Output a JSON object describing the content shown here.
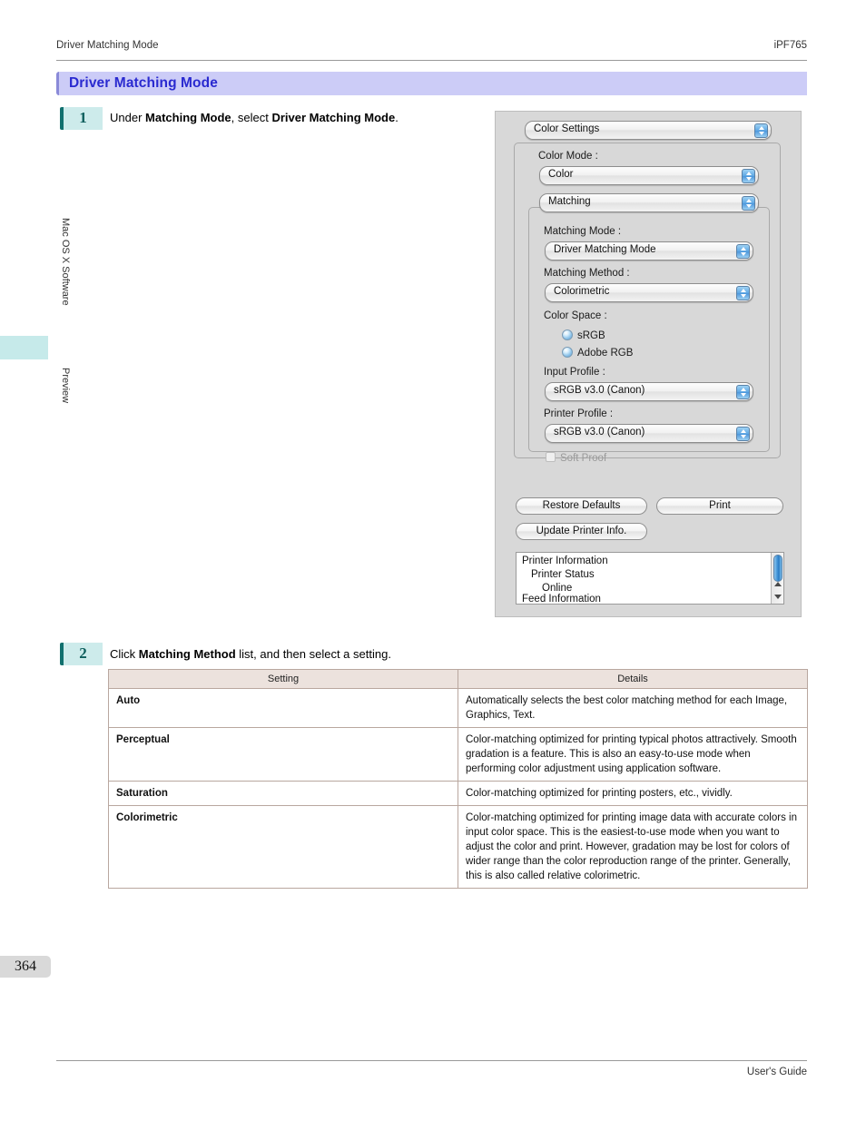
{
  "header": {
    "left": "Driver Matching Mode",
    "right": "iPF765"
  },
  "section": {
    "title": "Driver Matching Mode",
    "title_bg": "#ccccf7",
    "title_color": "#2a2ad0"
  },
  "side_tabs": {
    "software": "Mac OS X Software",
    "preview": "Preview",
    "marker_color": "#c6eaea"
  },
  "steps": [
    {
      "number": "1",
      "parts": [
        {
          "text": "Under ",
          "bold": false
        },
        {
          "text": "Matching Mode",
          "bold": true
        },
        {
          "text": ", select ",
          "bold": false
        },
        {
          "text": "Driver Matching Mode",
          "bold": true
        },
        {
          "text": ".",
          "bold": false
        }
      ]
    },
    {
      "number": "2",
      "parts": [
        {
          "text": "Click ",
          "bold": false
        },
        {
          "text": "Matching Method",
          "bold": true
        },
        {
          "text": " list, and then select a setting.",
          "bold": false
        }
      ]
    }
  ],
  "dialog": {
    "pane_popup": "Color Settings",
    "color_mode_label": "Color Mode :",
    "color_mode_value": "Color",
    "matching_popup": "Matching",
    "matching_mode_label": "Matching Mode :",
    "matching_mode_value": "Driver Matching Mode",
    "matching_method_label": "Matching Method :",
    "matching_method_value": "Colorimetric",
    "color_space_label": "Color Space :",
    "radio_srgb": "sRGB",
    "radio_adobe_rgb": "Adobe RGB",
    "input_profile_label": "Input Profile :",
    "input_profile_value": "sRGB v3.0 (Canon)",
    "printer_profile_label": "Printer Profile :",
    "printer_profile_value": "sRGB v3.0 (Canon)",
    "soft_proof": "Soft Proof",
    "btn_restore_defaults": "Restore Defaults",
    "btn_print": "Print",
    "btn_update_printer_info": "Update Printer Info.",
    "info_lines": [
      "Printer Information",
      "Printer Status",
      "Online",
      "Feed Information"
    ]
  },
  "table": {
    "headers": [
      "Setting",
      "Details"
    ],
    "rows": [
      {
        "setting": "Auto",
        "details": "Automatically selects the best color matching method for each Image, Graphics, Text."
      },
      {
        "setting": "Perceptual",
        "details": "Color-matching optimized for printing typical photos attractively. Smooth gradation is a feature. This is also an easy-to-use mode when performing color adjustment using application software."
      },
      {
        "setting": "Saturation",
        "details": "Color-matching optimized for printing posters, etc., vividly."
      },
      {
        "setting": "Colorimetric",
        "details": "Color-matching optimized for printing image data with accurate colors in input color space. This is the easiest-to-use mode when you want to adjust the color and print. However, gradation may be lost for colors of wider range than the color reproduction range of the printer. Generally, this is also called relative colorimetric."
      }
    ]
  },
  "page_number": "364",
  "footer": "User's Guide"
}
